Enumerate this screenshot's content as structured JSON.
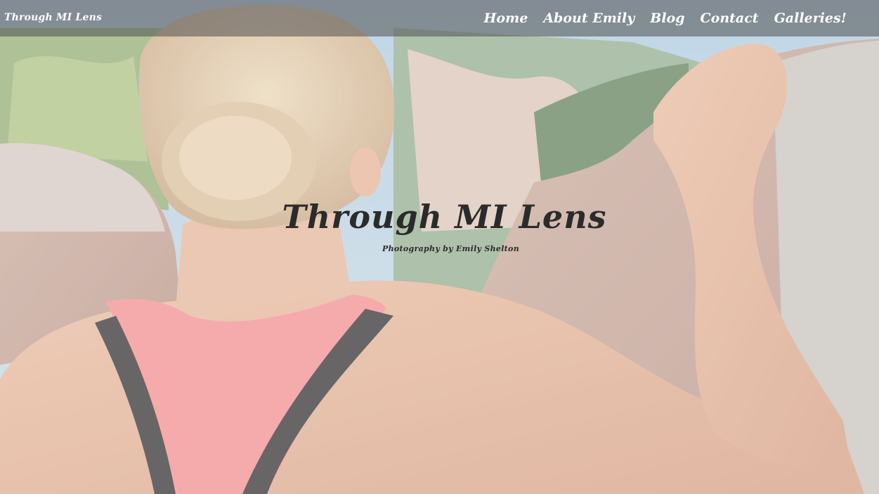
{
  "site": {
    "brand": "Through MI Lens"
  },
  "nav": {
    "items": [
      {
        "label": "Home"
      },
      {
        "label": "About Emily"
      },
      {
        "label": "Blog"
      },
      {
        "label": "Contact"
      },
      {
        "label": "Galleries!"
      }
    ]
  },
  "hero": {
    "title": "Through MI Lens",
    "subtitle": "Photography by Emily Shelton"
  },
  "colors": {
    "navbar_background": "#505050",
    "nav_text": "#ffffff",
    "hero_text": "#2b2b2b"
  }
}
